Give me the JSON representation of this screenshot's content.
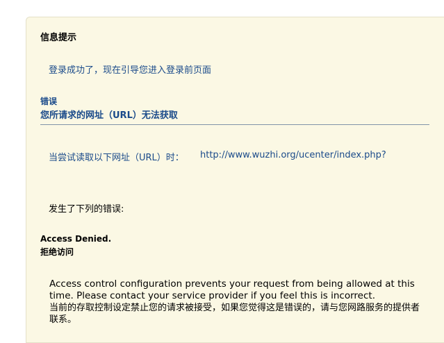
{
  "panel": {
    "title": "信息提示",
    "success_message": "登录成功了，现在引导您进入登录前页面"
  },
  "error": {
    "label": "错误",
    "heading": "您所请求的网址（URL）无法获取",
    "attempt_text": "当尝试读取以下网址（URL）时：",
    "url": "http://www.wuzhi.org/ucenter/index.php?",
    "occurred_text": "发生了下列的错误:",
    "denied_en": "Access Denied.",
    "denied_cn": "拒绝访问",
    "message_en": "Access control configuration prevents your request from being allowed at this time. Please contact your service provider if you feel this is incorrect.",
    "message_cn": "当前的存取控制设定禁止您的请求被接受，如果您觉得这是错误的，请与您网路服务的提供者联系。"
  },
  "colors": {
    "panel_bg": "#fbf8e4",
    "link": "#1a4a8a",
    "divider": "#7f93a8"
  }
}
